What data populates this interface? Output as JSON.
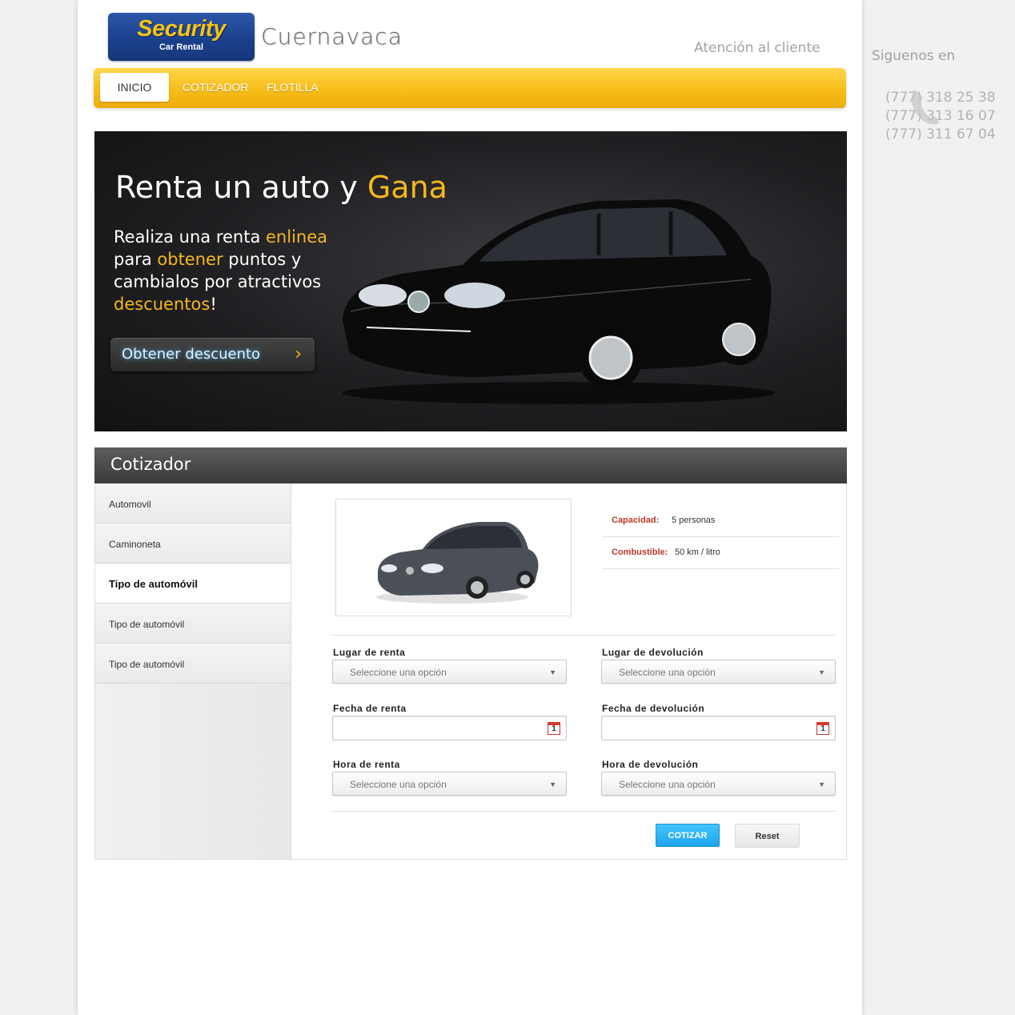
{
  "header": {
    "logo_brand": "Security",
    "logo_sub": "Car Rental",
    "city": "Cuernavaca",
    "atencion": "Atención al cliente"
  },
  "nav": {
    "items": [
      {
        "label": "INICIO",
        "active": true
      },
      {
        "label": "COTIZADOR",
        "active": false
      },
      {
        "label": "FLOTILLA",
        "active": false
      }
    ]
  },
  "hero": {
    "title_a": "Renta un auto y ",
    "title_b": "Gana",
    "line1_a": "Realiza una renta ",
    "line1_b": "enlinea",
    "line2_a": "para ",
    "line2_b": "obtener",
    "line2_c": " puntos y",
    "line3": "cambialos por atractivos",
    "line4_a": "descuentos",
    "line4_b": "!",
    "button": "Obtener descuento",
    "button_arrow": "›"
  },
  "cotizador": {
    "title": "Cotizador",
    "side_items": [
      {
        "label": "Automovil",
        "active": false
      },
      {
        "label": "Caminoneta",
        "active": false
      },
      {
        "label": "Tipo de automóvil",
        "active": true
      },
      {
        "label": "Tipo de automóvil",
        "active": false
      },
      {
        "label": "Tipo de automóvil",
        "active": false
      }
    ],
    "specs": {
      "capacidad_label": "Capacidad:",
      "capacidad_value": "5 personas",
      "combustible_label": "Combustible:",
      "combustible_value": "50 km / litro"
    },
    "form": {
      "lugar_renta": "Lugar de renta",
      "lugar_devolucion": "Lugar de devolución",
      "fecha_renta": "Fecha de renta",
      "fecha_devolucion": "Fecha de devolución",
      "hora_renta": "Hora de renta",
      "hora_devolucion": "Hora de devolución",
      "select_placeholder": "Seleccione una opción",
      "calendar_day": "1"
    },
    "buttons": {
      "cotizar": "COTIZAR",
      "reset": "Reset"
    }
  },
  "sidebar_right": {
    "siguenos": "Siguenos en",
    "phones": [
      "(777) 318 25 38",
      "(777) 313 16 07",
      "(777) 311 67 04"
    ]
  },
  "colors": {
    "accent_yellow": "#f7be18",
    "highlight_orange": "#f5b81c",
    "label_red": "#c0392b",
    "button_blue": "#1ea4ea"
  }
}
